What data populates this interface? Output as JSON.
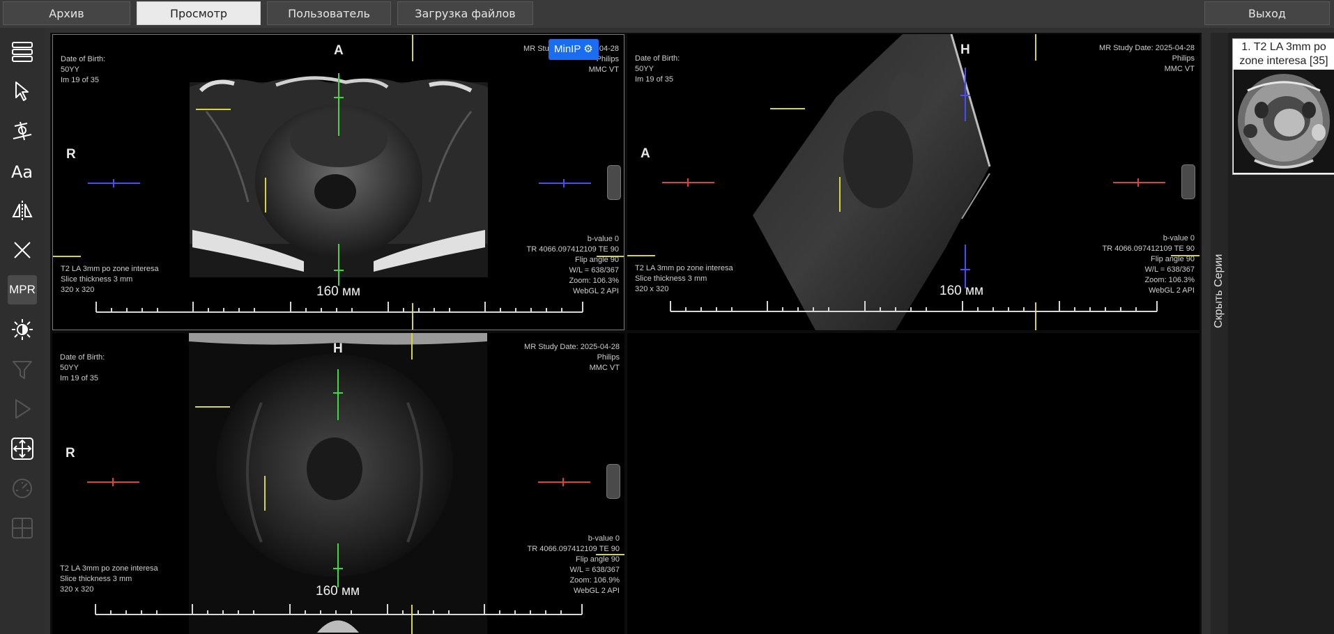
{
  "topbar": {
    "tabs": [
      {
        "label": "Архив"
      },
      {
        "label": "Просмотр"
      },
      {
        "label": "Пользователь"
      },
      {
        "label": "Загрузка файлов"
      }
    ],
    "exit_label": "Выход"
  },
  "toolbar": {
    "mpr_label": "MPR"
  },
  "viewports": [
    {
      "dob_label": "Date of Birth:",
      "age": "50YY",
      "image_index": "Im 19 of 35",
      "study_date": "MR Study Date: 2025-04-28",
      "manufacturer": "Philips",
      "institution": "MMC VT",
      "orient_top": "A",
      "orient_left": "R",
      "series_desc": "T2 LA 3mm po zone interesa",
      "slice_thickness": "Slice thickness 3 mm",
      "matrix": "320 x 320",
      "bvalue": "b-value 0",
      "tr_te": "TR 4066.097412109 TE 90",
      "flip": "Flip angle 90",
      "wl": "W/L = 638/367",
      "zoom": "Zoom: 106.3%",
      "renderer": "WebGL 2 API",
      "scale": "160 мм",
      "minip": "MinIP"
    },
    {
      "dob_label": "Date of Birth:",
      "age": "50YY",
      "image_index": "Im 19 of 35",
      "study_date": "MR Study Date: 2025-04-28",
      "manufacturer": "Philips",
      "institution": "MMC VT",
      "orient_top": "H",
      "orient_left": "A",
      "series_desc": "T2 LA 3mm po zone interesa",
      "slice_thickness": "Slice thickness 3 mm",
      "matrix": "320 x 320",
      "bvalue": "b-value 0",
      "tr_te": "TR 4066.097412109 TE 90",
      "flip": "Flip angle 90",
      "wl": "W/L = 638/367",
      "zoom": "Zoom: 106.3%",
      "renderer": "WebGL 2 API",
      "scale": "160 мм"
    },
    {
      "dob_label": "Date of Birth:",
      "age": "50YY",
      "image_index": "Im 19 of 35",
      "study_date": "MR Study Date: 2025-04-28",
      "manufacturer": "Philips",
      "institution": "MMC VT",
      "orient_top": "H",
      "orient_left": "R",
      "series_desc": "T2 LA 3mm po zone interesa",
      "slice_thickness": "Slice thickness 3 mm",
      "matrix": "320 x 320",
      "bvalue": "b-value 0",
      "tr_te": "TR 4066.097412109 TE 90",
      "flip": "Flip angle 90",
      "wl": "W/L = 638/367",
      "zoom": "Zoom: 106.9%",
      "renderer": "WebGL 2 API",
      "scale": "160 мм"
    }
  ],
  "side": {
    "hide_series_label": "Скрыть Серии"
  },
  "series": {
    "items": [
      {
        "title": "1. T2 LA 3mm po zone interesa [35]"
      }
    ]
  },
  "colors": {
    "accent": "#1a6df0",
    "crosshair_green": "#3ddc3d",
    "crosshair_blue": "#4a4aff",
    "crosshair_red": "#e04040",
    "ref_yellow": "#d6d63a"
  }
}
